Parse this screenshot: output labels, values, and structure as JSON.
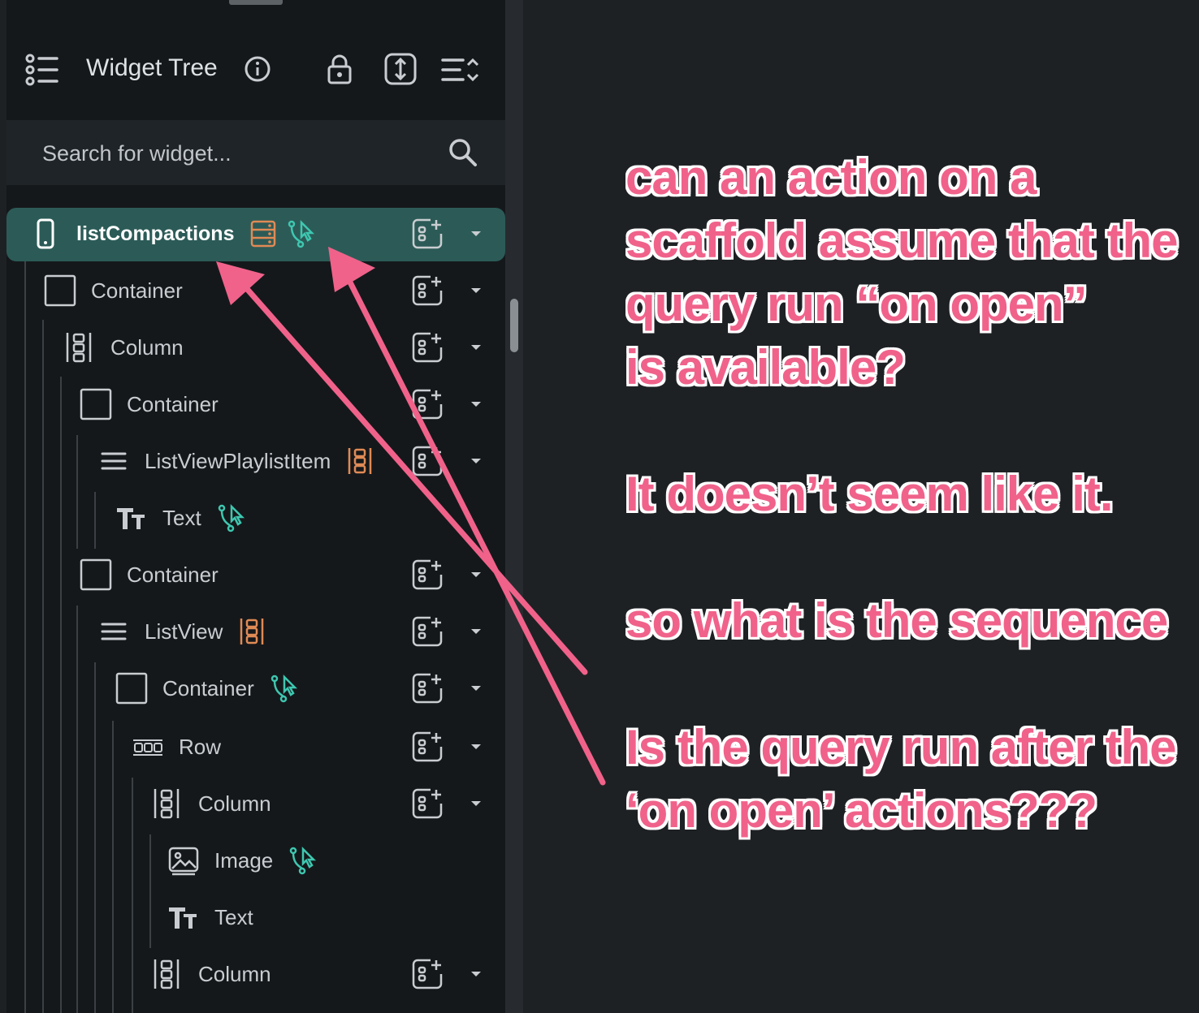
{
  "panel": {
    "title": "Widget Tree",
    "search_placeholder": "Search for widget..."
  },
  "tree": [
    {
      "label": "listCompactions",
      "icon": "phone-icon",
      "extras": [
        "backend-query-icon",
        "action-trigger-icon"
      ],
      "add": true,
      "caret": true,
      "selected": true
    },
    {
      "label": "Container",
      "icon": "container-icon",
      "extras": [],
      "add": true,
      "caret": true
    },
    {
      "label": "Column",
      "icon": "column-icon",
      "extras": [],
      "add": true,
      "caret": true
    },
    {
      "label": "Container",
      "icon": "container-icon",
      "extras": [],
      "add": true,
      "caret": true
    },
    {
      "label": "ListViewPlaylistItem",
      "icon": "listview-icon",
      "extras": [
        "generate-children-icon"
      ],
      "add": true,
      "caret": true
    },
    {
      "label": "Text",
      "icon": "text-icon",
      "extras": [
        "action-trigger-icon"
      ],
      "add": false,
      "caret": false
    },
    {
      "label": "Container",
      "icon": "container-icon",
      "extras": [],
      "add": true,
      "caret": true
    },
    {
      "label": "ListView",
      "icon": "listview-icon",
      "extras": [
        "generate-children-icon"
      ],
      "add": true,
      "caret": true
    },
    {
      "label": "Container",
      "icon": "container-icon",
      "extras": [
        "action-trigger-icon"
      ],
      "add": true,
      "caret": true
    },
    {
      "label": "Row",
      "icon": "row-icon",
      "extras": [],
      "add": true,
      "caret": true
    },
    {
      "label": "Column",
      "icon": "column-icon",
      "extras": [],
      "add": true,
      "caret": true
    },
    {
      "label": "Image",
      "icon": "image-icon",
      "extras": [
        "action-trigger-icon"
      ],
      "add": false,
      "caret": false
    },
    {
      "label": "Text",
      "icon": "text-icon",
      "extras": [],
      "add": false,
      "caret": false
    },
    {
      "label": "Column",
      "icon": "column-icon",
      "extras": [],
      "add": true,
      "caret": true
    }
  ],
  "annotation": {
    "lines": [
      "can an action on a",
      "scaffold assume that the",
      "query run “on open”",
      "is available?",
      "",
      "It doesn’t seem like it.",
      "",
      "so what is the sequence",
      "",
      "Is the query run after the",
      "‘on open’ actions???"
    ]
  },
  "colors": {
    "selected_row": "#2c5b57",
    "action_icon": "#3ec7b0",
    "query_icon": "#e08a55",
    "annotation": "#f0628a"
  }
}
